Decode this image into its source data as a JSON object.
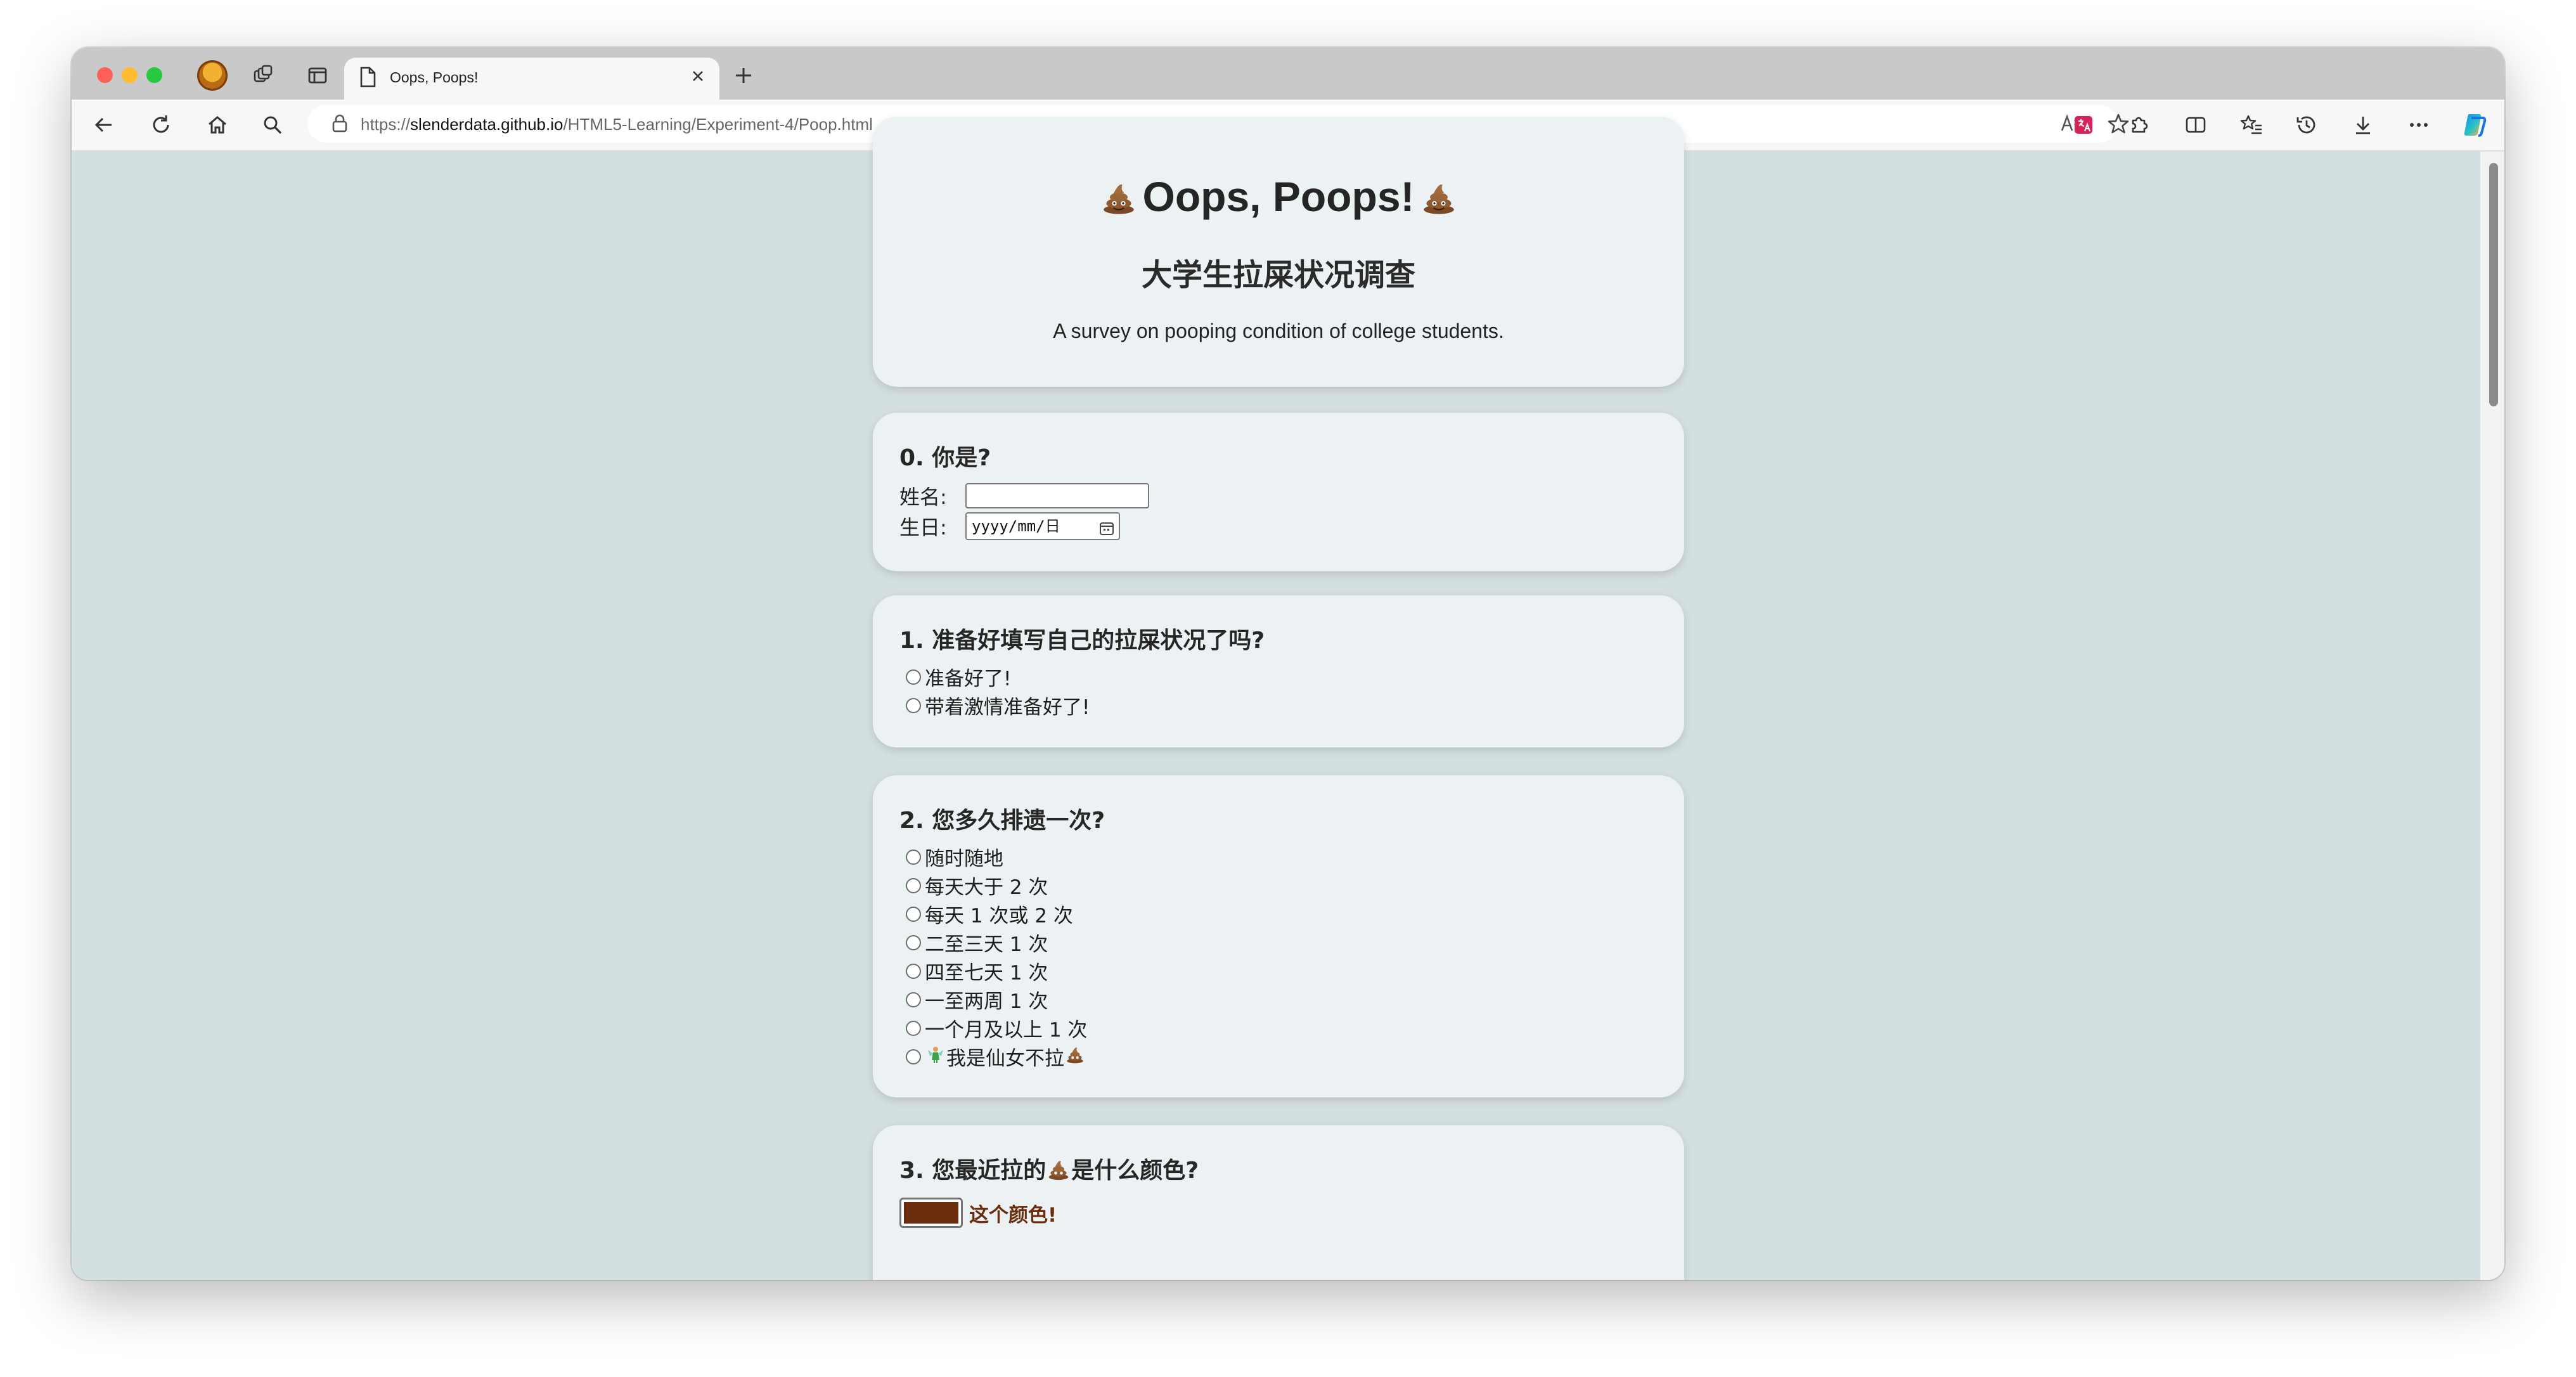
{
  "browser": {
    "tab_title": "Oops, Poops!",
    "url_prefix": "https://",
    "url_host": "slenderdata.github.io",
    "url_path": "/HTML5-Learning/Experiment-4/Poop.html"
  },
  "header": {
    "title": "Oops, Poops!",
    "subtitle": "大学生拉屎状况调查",
    "description": "A survey on pooping condition of college students."
  },
  "q0": {
    "title": "0. 你是?",
    "name_label": "姓名:",
    "name_value": "",
    "birthday_label": "生日:",
    "birthday_placeholder": "yyyy/mm/日"
  },
  "q1": {
    "title": "1. 准备好填写自己的拉屎状况了吗?",
    "options": [
      "准备好了!",
      "带着激情准备好了!"
    ]
  },
  "q2": {
    "title": "2. 您多久排遗一次?",
    "options": [
      "随时随地",
      "每天大于 2 次",
      "每天 1 次或 2 次",
      "二至三天 1 次",
      "四至七天 1 次",
      "一至两周 1 次",
      "一个月及以上 1 次"
    ],
    "last_option_text": "我是仙女不拉"
  },
  "q3": {
    "title_before": "3. 您最近拉的",
    "title_after": "是什么颜色?",
    "color_value": "#6b2d0e",
    "color_label": "这个颜色!",
    "color_label_color": "#6b2d0e"
  },
  "icons": {
    "poop": "pile-of-poo-icon",
    "fairy": "fairy-icon"
  },
  "colors": {
    "page_background": "#d4dfe1",
    "card_background": "#ecf2f3"
  }
}
